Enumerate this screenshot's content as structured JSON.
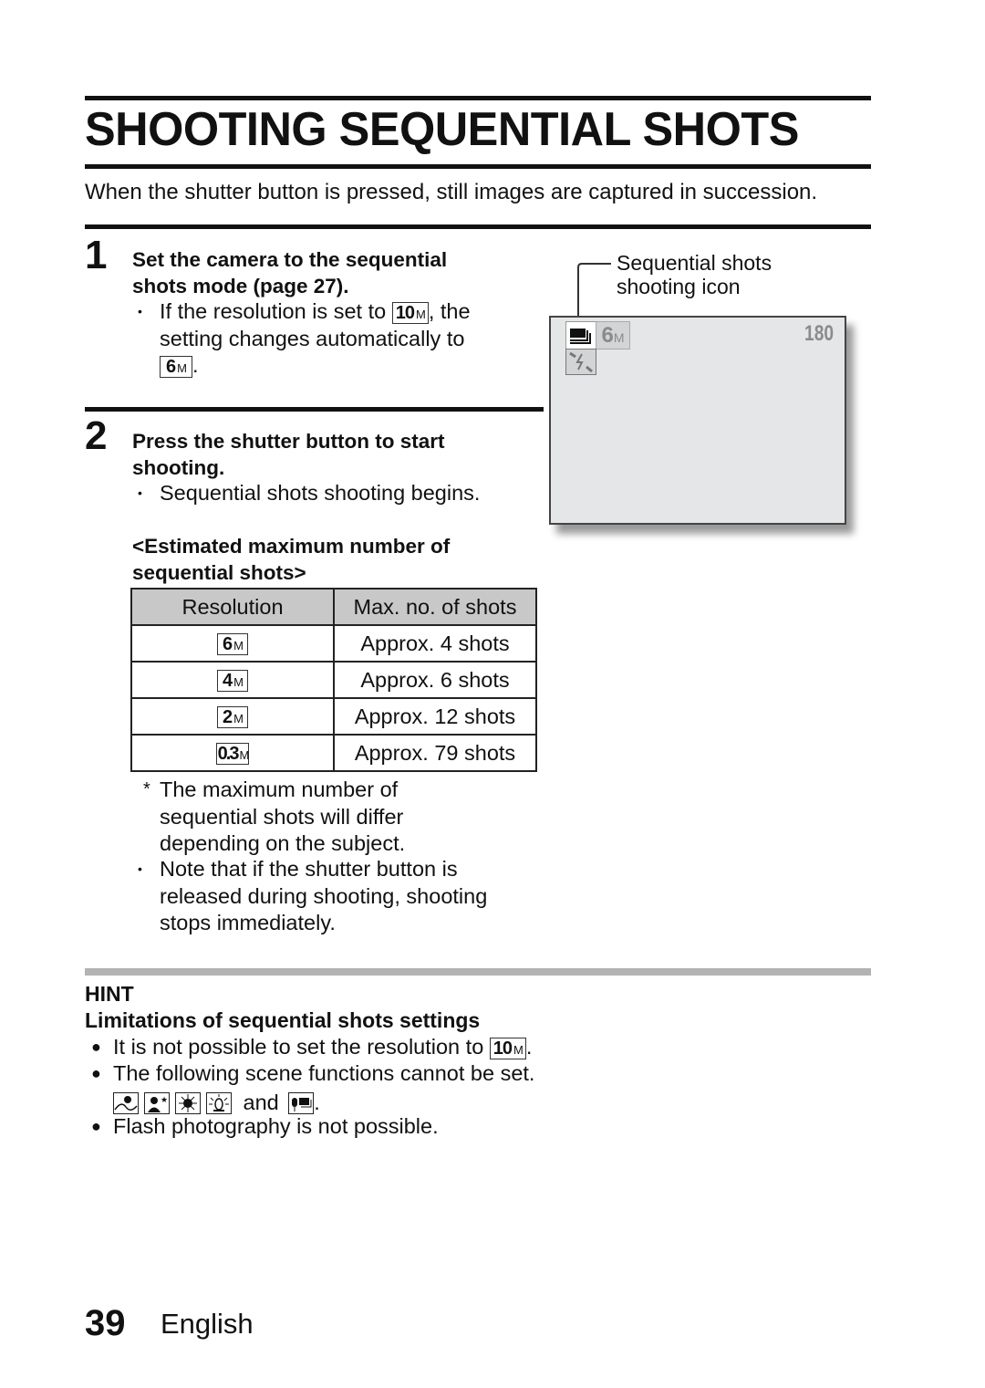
{
  "page": {
    "title": "SHOOTING SEQUENTIAL SHOTS",
    "intro": "When the shutter button is pressed, still images are captured in succession.",
    "page_number": "39",
    "language": "English"
  },
  "step1": {
    "number": "1",
    "heading_line1": "Set the camera to the sequential",
    "heading_line2": "shots mode (page 27).",
    "bullet_text_a": "If the resolution is set to",
    "bullet_badge_a": "10",
    "bullet_text_b": ", the",
    "bullet_line2": "setting changes automatically to",
    "bullet_badge_b": "6",
    "bullet_end": "."
  },
  "step2": {
    "number": "2",
    "heading_line1": "Press the shutter button to start",
    "heading_line2": "shooting.",
    "bullet": "Sequential shots shooting begins.",
    "table_caption_line1": "<Estimated maximum number of",
    "table_caption_line2": "sequential shots>"
  },
  "table": {
    "headers": [
      "Resolution",
      "Max. no. of shots"
    ],
    "rows": [
      {
        "resolution": "6",
        "unit": "M",
        "shots": "Approx. 4 shots"
      },
      {
        "resolution": "4",
        "unit": "M",
        "shots": "Approx. 6 shots"
      },
      {
        "resolution": "2",
        "unit": "M",
        "shots": "Approx. 12 shots"
      },
      {
        "resolution": "0.3",
        "unit": "M",
        "shots": "Approx. 79 shots"
      }
    ]
  },
  "notes": {
    "asterisk": "*",
    "asterisk_line1": "The maximum number of",
    "asterisk_line2": "sequential shots will differ",
    "asterisk_line3": "depending on the subject.",
    "bullet_line1": "Note that if the shutter button is",
    "bullet_line2": "released during shooting, shooting",
    "bullet_line3": "stops immediately."
  },
  "lcd": {
    "callout_line1": "Sequential shots",
    "callout_line2": "shooting icon",
    "resolution": "6",
    "unit": "M",
    "remaining": "180",
    "icons": [
      "sequential-shots-icon",
      "flash-off-icon"
    ]
  },
  "hint": {
    "label": "HINT",
    "heading": "Limitations of sequential shots settings",
    "item1_text": "It is not possible to set the resolution to",
    "item1_badge": "10",
    "item1_end": ".",
    "item2_text": "The following scene functions cannot be set.",
    "item2_and": "and",
    "item2_end": ".",
    "scene_icons": [
      "landscape-icon",
      "night-portrait-icon",
      "fireworks-icon",
      "lamp-icon",
      "text-icon"
    ],
    "item3_text": "Flash photography is not possible.",
    "unit": "M"
  }
}
